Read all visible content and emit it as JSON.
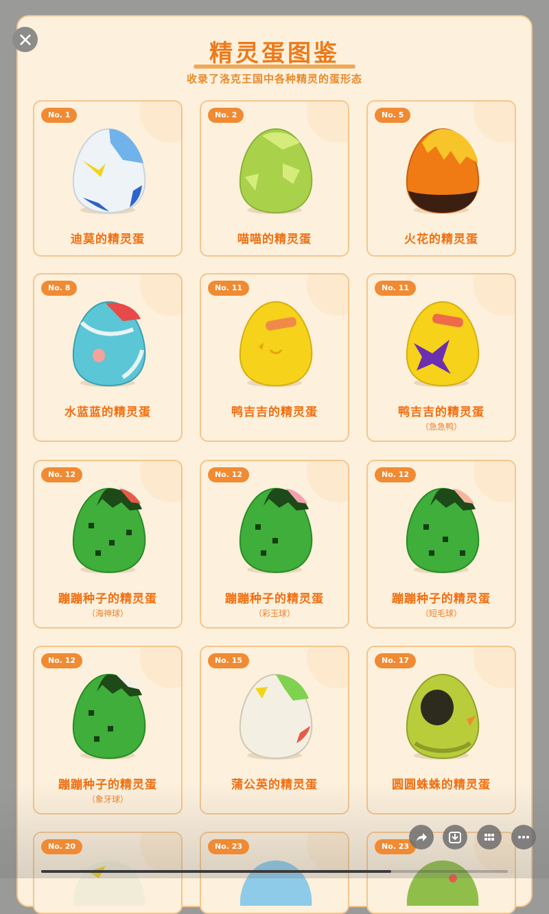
{
  "header": {
    "title": "精灵蛋图鉴",
    "subtitle": "收录了洛克王国中各种精灵的蛋形态"
  },
  "cards": [
    {
      "no": "No. 1",
      "name": "迪莫的精灵蛋",
      "variant": "",
      "egg": "blue-white-egg"
    },
    {
      "no": "No. 2",
      "name": "喵喵的精灵蛋",
      "variant": "",
      "egg": "green-yellow-egg"
    },
    {
      "no": "No. 5",
      "name": "火花的精灵蛋",
      "variant": "",
      "egg": "orange-black-egg"
    },
    {
      "no": "No. 8",
      "name": "水蓝蓝的精灵蛋",
      "variant": "",
      "egg": "cyan-egg"
    },
    {
      "no": "No. 11",
      "name": "鸭吉吉的精灵蛋",
      "variant": "",
      "egg": "yellow-egg"
    },
    {
      "no": "No. 11",
      "name": "鸭吉吉的精灵蛋",
      "variant": "（急急鸭）",
      "egg": "yellow-purple-egg"
    },
    {
      "no": "No. 12",
      "name": "蹦蹦种子的精灵蛋",
      "variant": "（海神球）",
      "egg": "green-egg"
    },
    {
      "no": "No. 12",
      "name": "蹦蹦种子的精灵蛋",
      "variant": "（彩玉球）",
      "egg": "green-pink-egg"
    },
    {
      "no": "No. 12",
      "name": "蹦蹦种子的精灵蛋",
      "variant": "（短毛球）",
      "egg": "green-egg"
    },
    {
      "no": "No. 12",
      "name": "蹦蹦种子的精灵蛋",
      "variant": "（象牙球）",
      "egg": "green-white-egg"
    },
    {
      "no": "No. 15",
      "name": "蒲公英的精灵蛋",
      "variant": "",
      "egg": "white-green-egg"
    },
    {
      "no": "No. 17",
      "name": "圆圆蛛蛛的精灵蛋",
      "variant": "",
      "egg": "olive-egg"
    },
    {
      "no": "No. 20",
      "name": "",
      "variant": "",
      "egg": "partial-egg"
    },
    {
      "no": "No. 23",
      "name": "",
      "variant": "",
      "egg": "partial-egg"
    },
    {
      "no": "No. 23",
      "name": "",
      "variant": "",
      "egg": "partial-egg"
    }
  ],
  "actions": {
    "share": "share-icon",
    "download": "download-icon",
    "grid": "grid-icon",
    "more": "more-icon"
  },
  "playback": {
    "progress": 0.75
  }
}
